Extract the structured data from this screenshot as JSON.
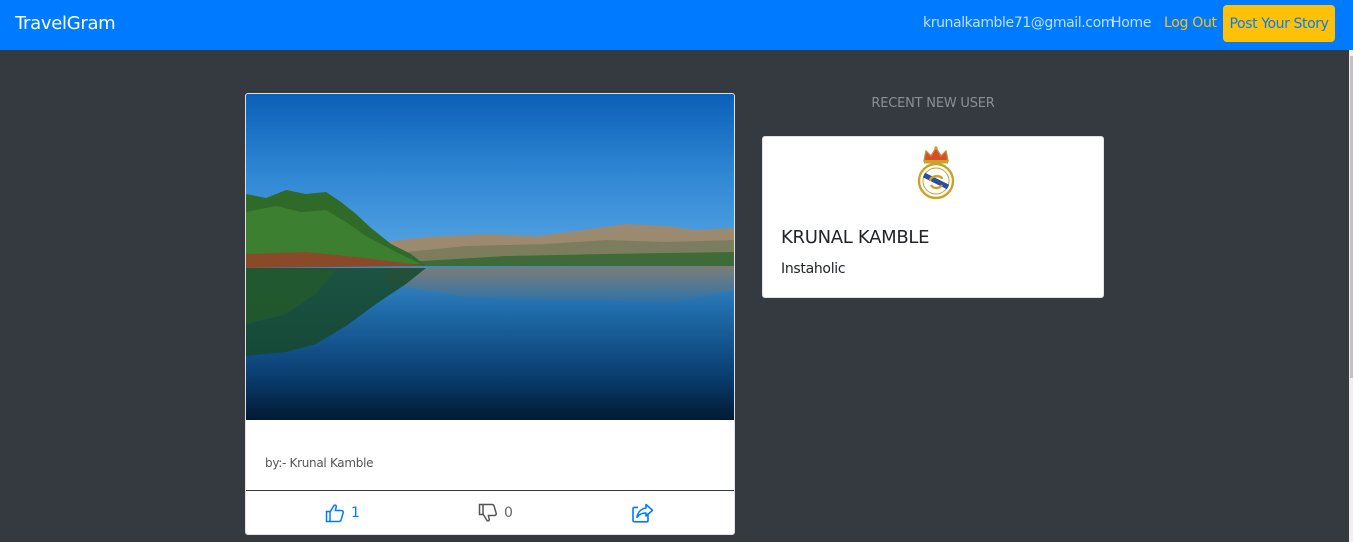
{
  "navbar": {
    "brand": "TravelGram",
    "email": "krunalkamble71@gmail.com",
    "home_label": "Home",
    "logout_label": "Log Out",
    "post_button_label": "Post Your Story",
    "colors": {
      "background": "#007bff",
      "accent": "#ffc107"
    }
  },
  "post": {
    "image_icon": "landscape-photo",
    "author": "by:- Krunal Kamble",
    "likes": "1",
    "dislikes": "0",
    "like_icon": "thumbs-up-icon",
    "dislike_icon": "thumbs-down-icon",
    "share_icon": "share-icon"
  },
  "sidebar": {
    "heading": "RECENT NEW USER",
    "user": {
      "avatar_icon": "crest-logo",
      "name": "KRUNAL KAMBLE",
      "bio": "Instaholic"
    }
  }
}
